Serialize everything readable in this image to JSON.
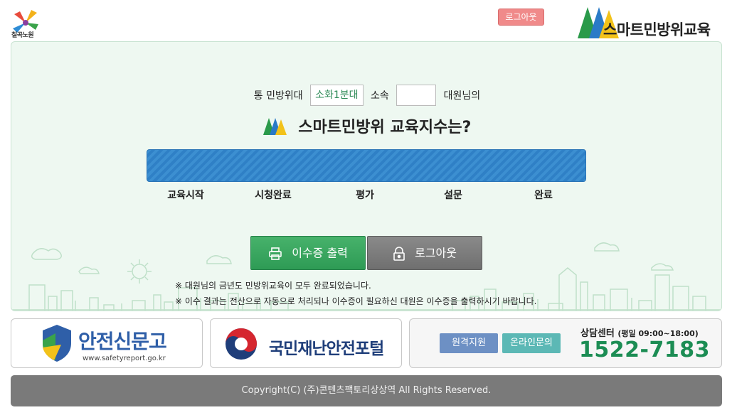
{
  "header": {
    "city_logo_text": "칠곡노원",
    "logout_label": "로그아웃",
    "brand_name": "스마트민방위교육"
  },
  "unit_info": {
    "prefix": "통 민방위대",
    "unit_name": "소화1분대",
    "affiliation_label": "소속",
    "affiliation_value": "",
    "suffix": "대원님의"
  },
  "index": {
    "title": "스마트민방위 교육지수는?",
    "progress_percent": 100,
    "steps": [
      "교육시작",
      "시청완료",
      "평가",
      "설문",
      "완료"
    ]
  },
  "actions": {
    "print_label": "이수증 출력",
    "logout_label": "로그아웃"
  },
  "notices": [
    "※ 대원님의 금년도 민방위교육이 모두 완료되었습니다.",
    "※ 이수 결과는 전산으로 자동으로 처리되나 이수증이 필요하신 대원은 이수증을 출력하시기 바랍니다."
  ],
  "banners": {
    "safety_report": {
      "name": "안전신문고",
      "url": "www.safetyreport.go.kr"
    },
    "disaster_portal": {
      "name": "국민재난안전포털"
    },
    "support": {
      "remote_label": "원격지원",
      "inquiry_label": "온라인문의",
      "center_label": "상담센터",
      "hours": "(평일 09:00~18:00)",
      "phone": "1522-7183"
    }
  },
  "footer": {
    "copyright": "Copyright(C) (주)콘텐츠팩토리상상역    All Rights Reserved."
  },
  "colors": {
    "panel_bg": "#eef8f1",
    "progress": "#3c8fd1",
    "print_button": "#3ea862",
    "logout_button": "#7c7c7c",
    "phone": "#1c8d54",
    "logout_small": "#f08a8a"
  },
  "icons": [
    "city-logo-icon",
    "brand-mountain-icon",
    "printer-icon",
    "lock-icon",
    "safety-shield-icon",
    "taegeuk-icon"
  ]
}
